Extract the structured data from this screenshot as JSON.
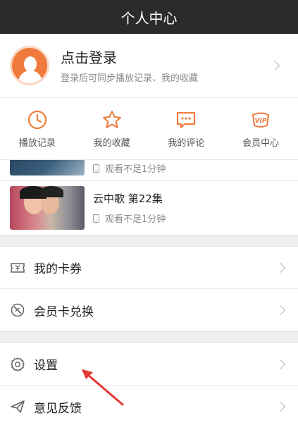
{
  "header": {
    "title": "个人中心"
  },
  "login": {
    "title": "点击登录",
    "subtitle": "登录后可同步播放记录、我的收藏"
  },
  "quick_actions": [
    {
      "label": "播放记录",
      "icon": "clock-icon"
    },
    {
      "label": "我的收藏",
      "icon": "star-icon"
    },
    {
      "label": "我的评论",
      "icon": "comment-icon"
    },
    {
      "label": "会员中心",
      "icon": "vip-icon"
    }
  ],
  "history": {
    "partial": {
      "watch": "观看不足1分钟"
    },
    "items": [
      {
        "title": "云中歌 第22集",
        "watch": "观看不足1分钟"
      }
    ]
  },
  "menu_group1": [
    {
      "label": "我的卡券",
      "icon": "coupon-icon"
    },
    {
      "label": "会员卡兑换",
      "icon": "exchange-icon"
    }
  ],
  "menu_group2": [
    {
      "label": "设置",
      "icon": "gear-icon"
    },
    {
      "label": "意见反馈",
      "icon": "feedback-icon"
    }
  ],
  "colors": {
    "accent": "#f07a3c",
    "header_bg": "#2b2b2b",
    "annotation": "#e53935"
  }
}
